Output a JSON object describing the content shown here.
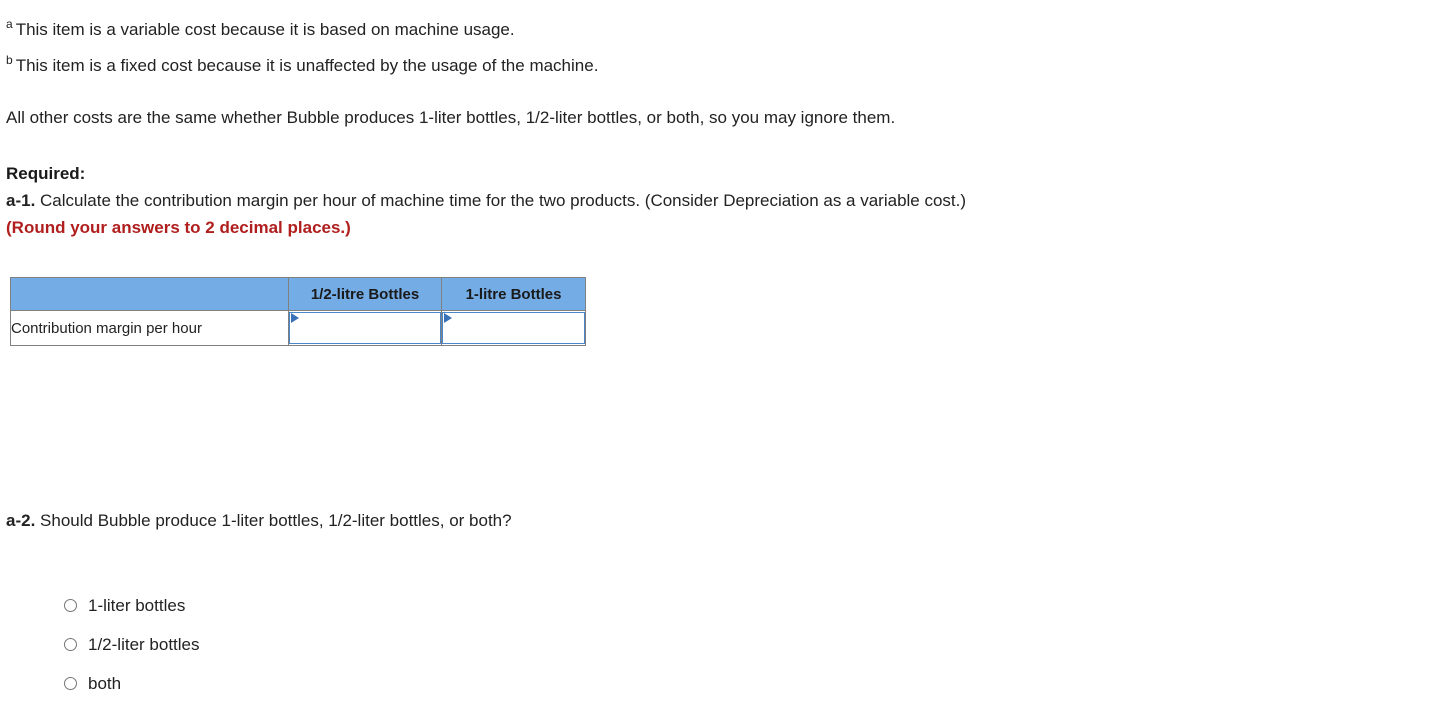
{
  "footnotes": [
    {
      "marker": "a",
      "text": "This item is a variable cost because it is based on machine usage."
    },
    {
      "marker": "b",
      "text": "This item is a fixed cost because it is unaffected by the usage of the machine."
    }
  ],
  "paragraph": "All other costs are the same whether Bubble produces 1-liter bottles, 1/2-liter bottles, or both, so you may ignore them.",
  "required": {
    "title": "Required:",
    "a1_label": "a-1.",
    "a1_text": "Calculate the contribution margin per hour of machine time for the two products. (Consider Depreciation as a variable cost.)",
    "round_note": "(Round your answers to 2 decimal places.)"
  },
  "table": {
    "headers": [
      "",
      "1/2-litre Bottles",
      "1-litre Bottles"
    ],
    "rows": [
      {
        "label": "Contribution margin per hour",
        "cells": [
          {
            "value": "",
            "placeholder": ""
          },
          {
            "value": "",
            "placeholder": ""
          }
        ]
      }
    ],
    "header_bg": "#74ace5",
    "input_border": "#4a86c8",
    "marker_color": "#3a72b8"
  },
  "question_a2": {
    "label": "a-2.",
    "text": "Should Bubble produce 1-liter bottles, 1/2-liter bottles, or both?"
  },
  "choices": [
    {
      "label": "1-liter bottles",
      "selected": false
    },
    {
      "label": "1/2-liter bottles",
      "selected": false
    },
    {
      "label": "both",
      "selected": false
    }
  ],
  "colors": {
    "accent_red": "#b01e1e",
    "header_blue": "#74ace5",
    "text": "#222222"
  }
}
